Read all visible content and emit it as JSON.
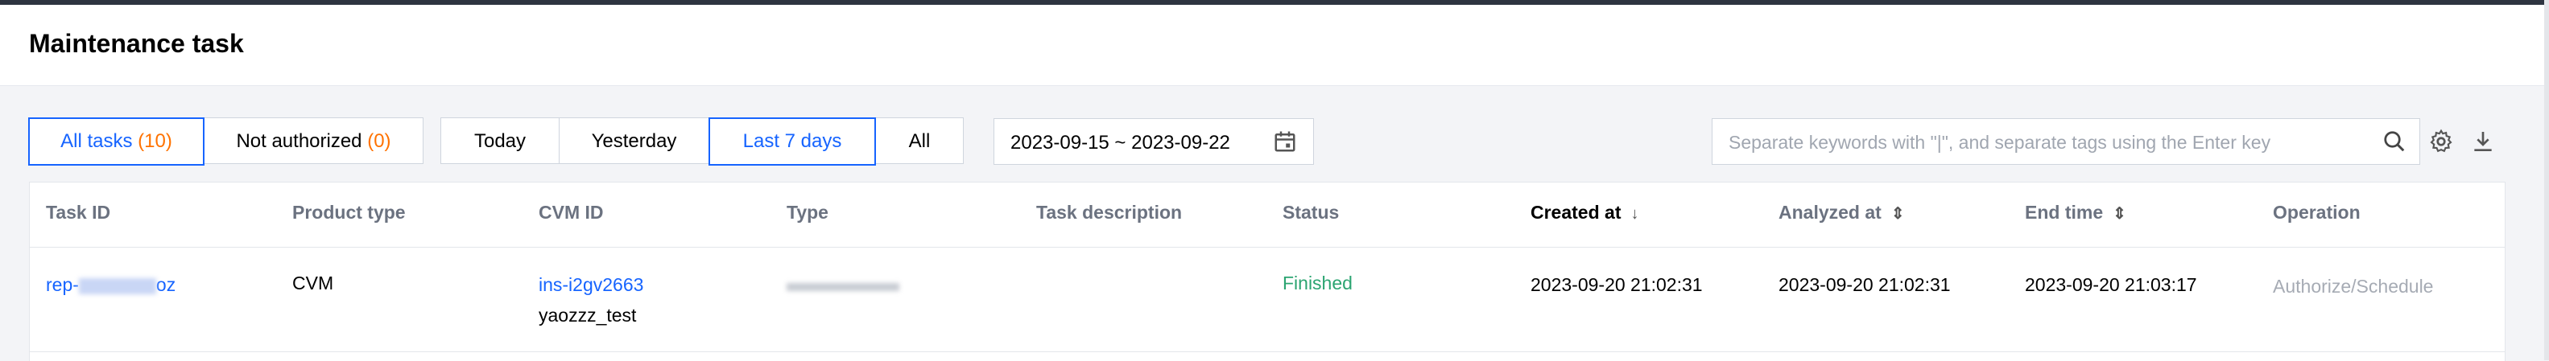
{
  "page": {
    "title": "Maintenance task"
  },
  "filters": {
    "task_tabs": [
      {
        "label": "All tasks",
        "count": "(10)",
        "active": true
      },
      {
        "label": "Not authorized",
        "count": "(0)",
        "active": false
      }
    ],
    "time_tabs": [
      {
        "label": "Today",
        "active": false
      },
      {
        "label": "Yesterday",
        "active": false
      },
      {
        "label": "Last 7 days",
        "active": true
      },
      {
        "label": "All",
        "active": false
      }
    ],
    "date_range": "2023-09-15 ~ 2023-09-22"
  },
  "search": {
    "placeholder": "Separate keywords with \"|\", and separate tags using the Enter key",
    "value": ""
  },
  "table": {
    "columns": [
      "Task ID",
      "Product type",
      "CVM ID",
      "Type",
      "Task description",
      "Status",
      "Created at",
      "Analyzed at",
      "End time",
      "Operation"
    ],
    "sort_icons": {
      "created_at": "↓",
      "analyzed_at": "⇕",
      "end_time": "⇕"
    },
    "rows": [
      {
        "task_id": "rep-",
        "task_id_tail": "oz",
        "product_type": "CVM",
        "cvm_id": "ins-i2gv2663",
        "cvm_name": "yaozzz_test",
        "type": "",
        "task_description": "",
        "status": "Finished",
        "created_at": "2023-09-20 21:02:31",
        "analyzed_at": "2023-09-20 21:02:31",
        "end_time": "2023-09-20 21:03:17",
        "operation": "Authorize/Schedule"
      }
    ]
  },
  "colors": {
    "accent": "#1664ff",
    "count": "#ff7200",
    "success": "#2ba471"
  }
}
